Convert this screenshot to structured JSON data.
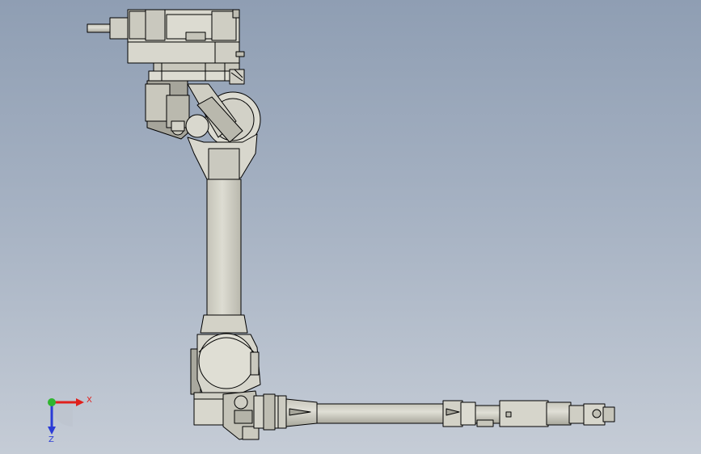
{
  "viewport": {
    "background_top": "#8f9eb3",
    "background_bottom": "#c5ccd6"
  },
  "model": {
    "part_color": "#d6d5cb",
    "shadow_color": "#a9a89e",
    "edge_color": "#000000"
  },
  "triad": {
    "x_label": "X",
    "z_label": "Z",
    "x_color": "#e0201c",
    "y_color": "#2fb52f",
    "z_color": "#2a3bd6"
  }
}
